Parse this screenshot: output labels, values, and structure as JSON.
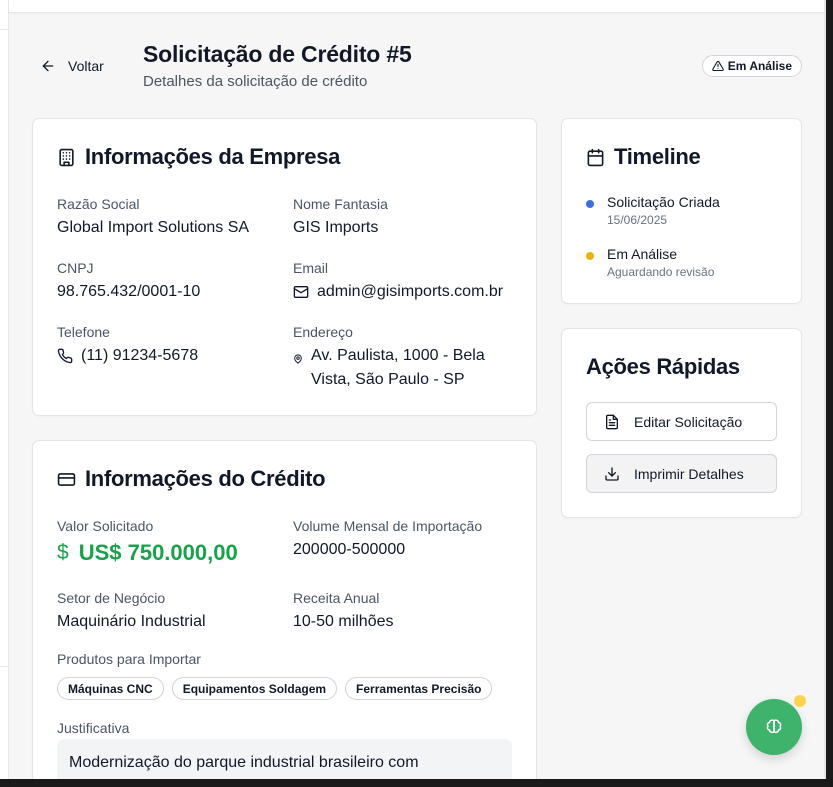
{
  "header": {
    "back_label": "Voltar",
    "title": "Solicitação de Crédito #5",
    "subtitle": "Detalhes da solicitação de crédito",
    "status": "Em Análise"
  },
  "company": {
    "title": "Informações da Empresa",
    "razao_social_label": "Razão Social",
    "razao_social": "Global Import Solutions SA",
    "nome_fantasia_label": "Nome Fantasia",
    "nome_fantasia": "GIS Imports",
    "cnpj_label": "CNPJ",
    "cnpj": "98.765.432/0001-10",
    "email_label": "Email",
    "email": "admin@gisimports.com.br",
    "telefone_label": "Telefone",
    "telefone": "(11) 91234-5678",
    "endereco_label": "Endereço",
    "endereco": "Av. Paulista, 1000 - Bela Vista, São Paulo - SP"
  },
  "credit": {
    "title": "Informações do Crédito",
    "valor_label": "Valor Solicitado",
    "valor": "US$ 750.000,00",
    "volume_label": "Volume Mensal de Importação",
    "volume": "200000-500000",
    "setor_label": "Setor de Negócio",
    "setor": "Maquinário Industrial",
    "receita_label": "Receita Anual",
    "receita": "10-50 milhões",
    "produtos_label": "Produtos para Importar",
    "produtos": [
      "Máquinas CNC",
      "Equipamentos Soldagem",
      "Ferramentas Precisão"
    ],
    "justificativa_label": "Justificativa",
    "justificativa": "Modernização do parque industrial brasileiro com"
  },
  "timeline": {
    "title": "Timeline",
    "items": [
      {
        "title": "Solicitação Criada",
        "sub": "15/06/2025",
        "color": "#3b6fe0"
      },
      {
        "title": "Em Análise",
        "sub": "Aguardando revisão",
        "color": "#eab308"
      }
    ]
  },
  "actions": {
    "title": "Ações Rápidas",
    "edit_label": "Editar Solicitação",
    "print_label": "Imprimir Detalhes"
  },
  "colors": {
    "accent_green": "#16a34a",
    "fab_green": "#3db36b",
    "fab_dot": "#fcd34d"
  }
}
